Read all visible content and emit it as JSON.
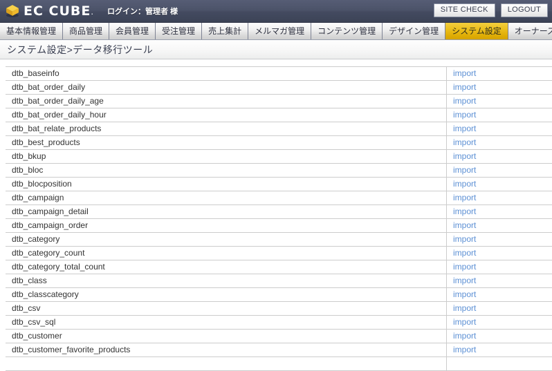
{
  "header": {
    "logo_text": "EC CUBE",
    "logo_icon": "cube-icon",
    "login_label": "ログイン：管理者 様",
    "site_check_label": "SITE CHECK",
    "logout_label": "LOGOUT",
    "bg_color": "#4a5068",
    "logo_cube_color": "#f2c12e"
  },
  "nav": {
    "tabs": [
      {
        "label": "基本情報管理",
        "active": false
      },
      {
        "label": "商品管理",
        "active": false
      },
      {
        "label": "会員管理",
        "active": false
      },
      {
        "label": "受注管理",
        "active": false
      },
      {
        "label": "売上集計",
        "active": false
      },
      {
        "label": "メルマガ管理",
        "active": false
      },
      {
        "label": "コンテンツ管理",
        "active": false
      },
      {
        "label": "デザイン管理",
        "active": false
      },
      {
        "label": "システム設定",
        "active": true
      },
      {
        "label": "オーナーズストア",
        "active": false
      }
    ],
    "active_color": "#e8b820"
  },
  "page": {
    "title": "システム設定>データ移行ツール"
  },
  "table": {
    "action_label": "import",
    "link_color": "#5b8fd4",
    "rows": [
      {
        "name": "dtb_baseinfo"
      },
      {
        "name": "dtb_bat_order_daily"
      },
      {
        "name": "dtb_bat_order_daily_age"
      },
      {
        "name": "dtb_bat_order_daily_hour"
      },
      {
        "name": "dtb_bat_relate_products"
      },
      {
        "name": "dtb_best_products"
      },
      {
        "name": "dtb_bkup"
      },
      {
        "name": "dtb_bloc"
      },
      {
        "name": "dtb_blocposition"
      },
      {
        "name": "dtb_campaign"
      },
      {
        "name": "dtb_campaign_detail"
      },
      {
        "name": "dtb_campaign_order"
      },
      {
        "name": "dtb_category"
      },
      {
        "name": "dtb_category_count"
      },
      {
        "name": "dtb_category_total_count"
      },
      {
        "name": "dtb_class"
      },
      {
        "name": "dtb_classcategory"
      },
      {
        "name": "dtb_csv"
      },
      {
        "name": "dtb_csv_sql"
      },
      {
        "name": "dtb_customer"
      },
      {
        "name": "dtb_customer_favorite_products"
      },
      {
        "name": ""
      }
    ]
  }
}
